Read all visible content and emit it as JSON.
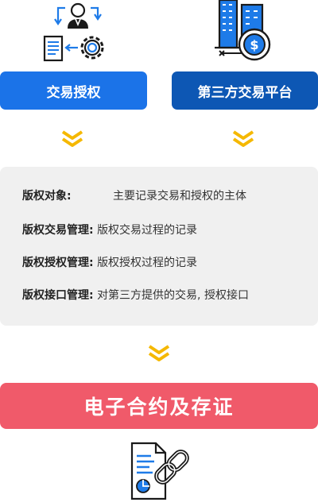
{
  "top": {
    "left_button": "交易授权",
    "right_button": "第三方交易平台"
  },
  "info": {
    "rows": [
      {
        "key": "版权对象:",
        "value": "主要记录交易和授权的主体"
      },
      {
        "key": "版权交易管理:",
        "value": "版权交易过程的记录"
      },
      {
        "key": "版权授权管理:",
        "value": "版权授权过程的记录"
      },
      {
        "key": "版权接口管理:",
        "value": "对第三方提供的交易, 授权接口"
      }
    ]
  },
  "bottom": {
    "title": "电子合约及存证"
  },
  "colors": {
    "blue": "#1b73e8",
    "dark_blue": "#0d57b4",
    "arrow_yellow": "#f5b800",
    "red": "#f05a6a",
    "box_gray": "#f0f0f0"
  }
}
